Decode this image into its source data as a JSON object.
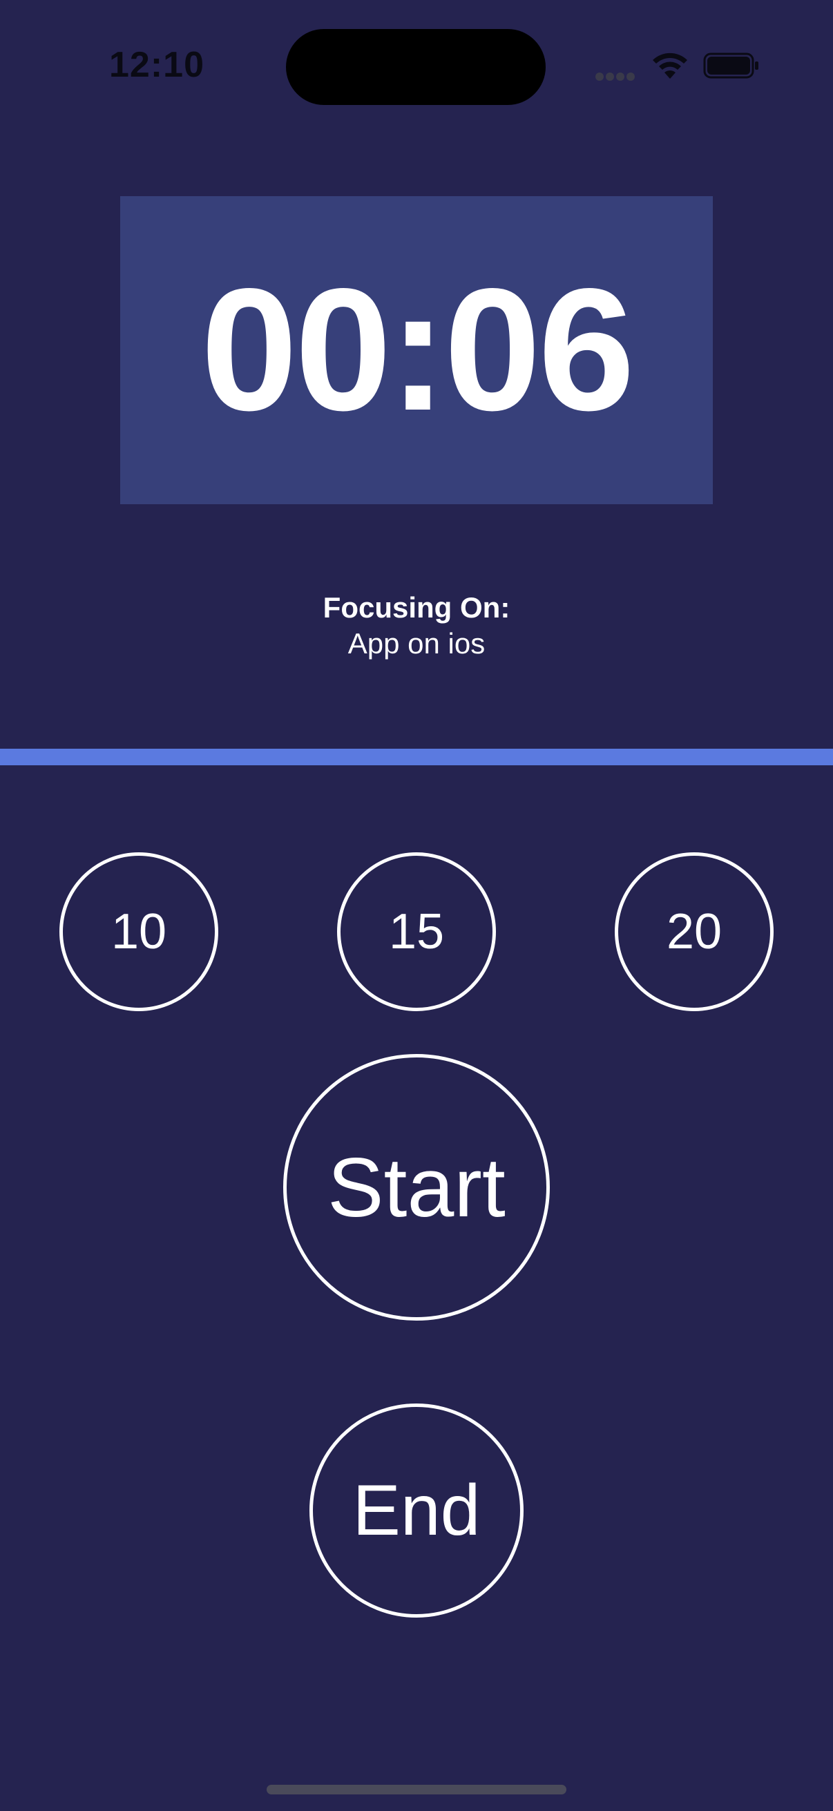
{
  "status_bar": {
    "time": "12:10",
    "icons": [
      "cellular-signal-icon",
      "wifi-icon",
      "battery-icon"
    ]
  },
  "timer": {
    "display": "00:06"
  },
  "focus": {
    "label": "Focusing On:",
    "value": "App on ios"
  },
  "presets": [
    {
      "label": "10"
    },
    {
      "label": "15"
    },
    {
      "label": "20"
    }
  ],
  "controls": {
    "start_label": "Start",
    "end_label": "End"
  },
  "colors": {
    "background": "#252350",
    "timer_panel": "#37407a",
    "divider": "#5b7ae0",
    "button_outline": "#ffffff"
  }
}
